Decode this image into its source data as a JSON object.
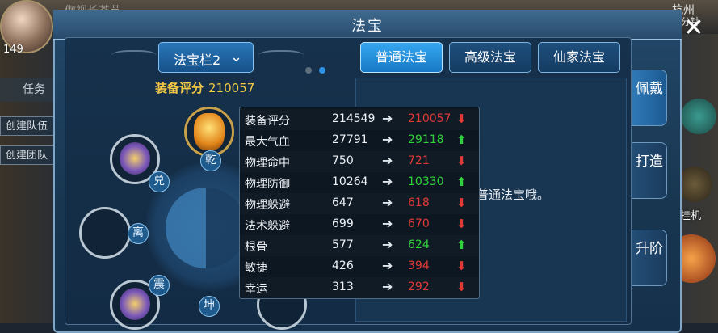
{
  "hud": {
    "player_level": "149",
    "player_name": "傲视长苍苏",
    "task_label": "任务",
    "buttons": [
      "创建队伍",
      "创建团队"
    ],
    "city": "杭州",
    "coord": "1:25 分钟 113",
    "auto_label": "挂机"
  },
  "window": {
    "title": "法宝",
    "close_glyph": "✕",
    "slot_select": {
      "label": "法宝栏2",
      "chevron": "⌄"
    },
    "score": {
      "label": "装备评分",
      "value": "210057"
    },
    "tabs": [
      {
        "label": "普通法宝",
        "active": true
      },
      {
        "label": "高级法宝",
        "active": false
      },
      {
        "label": "仙家法宝",
        "active": false
      }
    ],
    "side_tabs": [
      "佩戴",
      "打造",
      "升阶"
    ],
    "empty_message": "没有普通法宝哦。",
    "trigrams": [
      "乾",
      "兑",
      "离",
      "震",
      "坤"
    ],
    "stats": [
      {
        "name": "装备评分",
        "old": "214549",
        "arrow": "➔",
        "new": "210057",
        "trend": "down"
      },
      {
        "name": "最大气血",
        "old": "27791",
        "arrow": "➔",
        "new": "29118",
        "trend": "up"
      },
      {
        "name": "物理命中",
        "old": "750",
        "arrow": "➔",
        "new": "721",
        "trend": "down"
      },
      {
        "name": "物理防御",
        "old": "10264",
        "arrow": "➔",
        "new": "10330",
        "trend": "up"
      },
      {
        "name": "物理躲避",
        "old": "647",
        "arrow": "➔",
        "new": "618",
        "trend": "down"
      },
      {
        "name": "法术躲避",
        "old": "699",
        "arrow": "➔",
        "new": "670",
        "trend": "down"
      },
      {
        "name": "根骨",
        "old": "577",
        "arrow": "➔",
        "new": "624",
        "trend": "up"
      },
      {
        "name": "敏捷",
        "old": "426",
        "arrow": "➔",
        "new": "394",
        "trend": "down"
      },
      {
        "name": "幸运",
        "old": "313",
        "arrow": "➔",
        "new": "292",
        "trend": "down"
      }
    ],
    "colors": {
      "up": "#2fd23a",
      "down": "#e03a36",
      "score": "#f3c844",
      "tab_active": "#1779c6"
    }
  }
}
